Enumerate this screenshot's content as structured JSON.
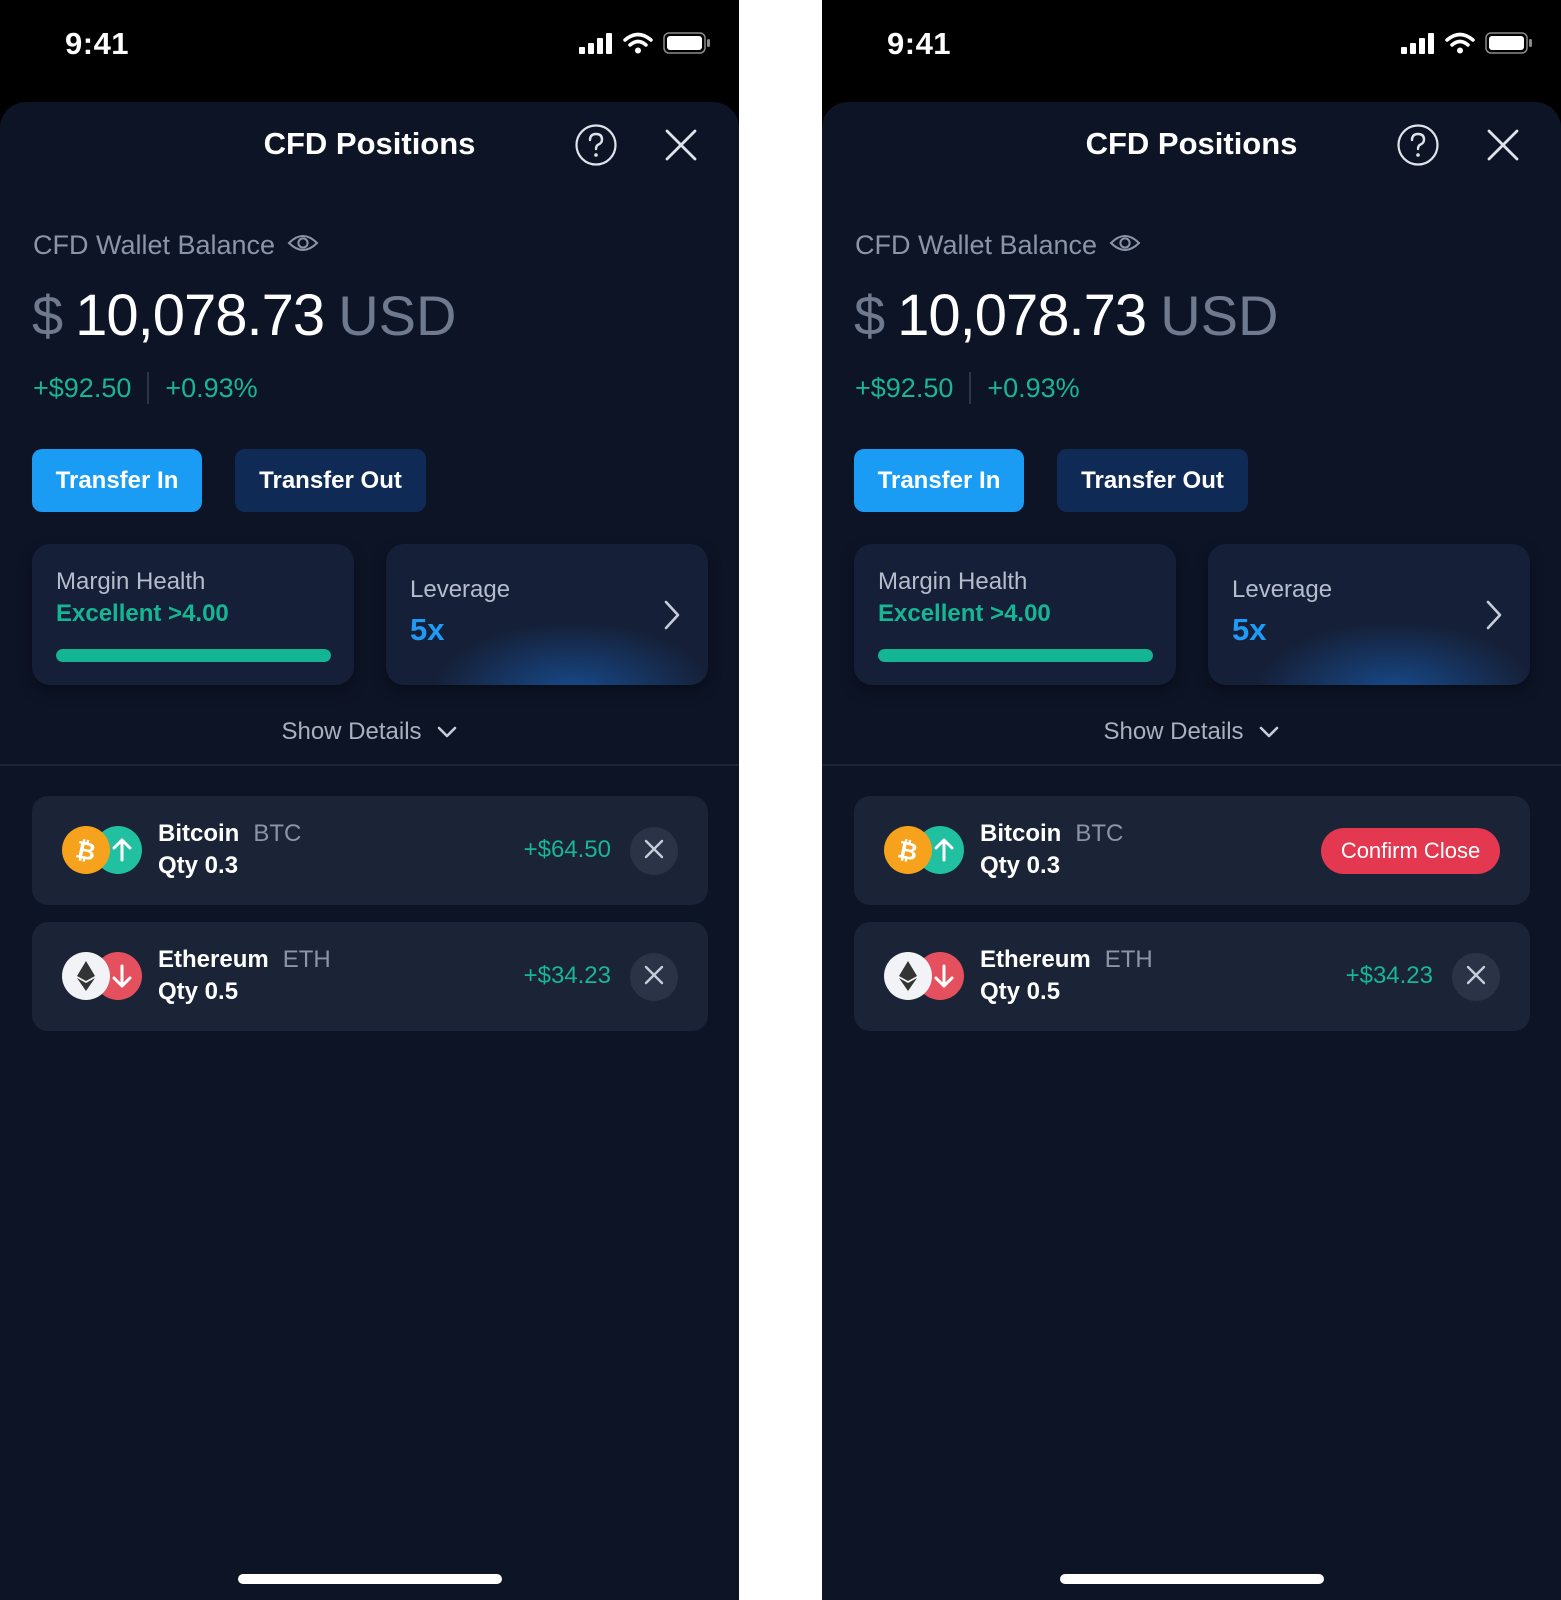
{
  "colors": {
    "accent_blue": "#1a9cf5",
    "positive_green": "#19b594",
    "confirm_red": "#e3384f",
    "sheet_background": "#0d1426",
    "card_background": "#152038"
  },
  "icons": {
    "help": "question-circle-icon",
    "close": "x-close-icon",
    "visibility": "eye-icon",
    "expand": "chevron-down-icon",
    "navigate": "chevron-right-icon",
    "bitcoin": "bitcoin-icon",
    "ethereum": "ethereum-icon",
    "long": "arrow-up-icon",
    "short": "arrow-down-icon"
  },
  "screens": [
    {
      "status": {
        "time": "9:41"
      },
      "header": {
        "title": "CFD Positions"
      },
      "balance": {
        "label": "CFD Wallet Balance",
        "currency_symbol": "$",
        "amount": "10,078.73",
        "unit": "USD",
        "change_amount": "+$92.50",
        "change_percent": "+0.93%"
      },
      "actions": {
        "transfer_in": "Transfer In",
        "transfer_out": "Transfer Out"
      },
      "margin": {
        "label": "Margin Health",
        "status": "Excellent >4.00",
        "fill_fraction": 1.0
      },
      "leverage": {
        "label": "Leverage",
        "value": "5x"
      },
      "details_toggle": "Show Details",
      "positions": [
        {
          "name": "Bitcoin",
          "symbol": "BTC",
          "qty": "Qty 0.3",
          "direction": "long",
          "pnl": "+$64.50",
          "confirm_label": ""
        },
        {
          "name": "Ethereum",
          "symbol": "ETH",
          "qty": "Qty 0.5",
          "direction": "short",
          "pnl": "+$34.23",
          "confirm_label": ""
        }
      ]
    },
    {
      "status": {
        "time": "9:41"
      },
      "header": {
        "title": "CFD Positions"
      },
      "balance": {
        "label": "CFD Wallet Balance",
        "currency_symbol": "$",
        "amount": "10,078.73",
        "unit": "USD",
        "change_amount": "+$92.50",
        "change_percent": "+0.93%"
      },
      "actions": {
        "transfer_in": "Transfer In",
        "transfer_out": "Transfer Out"
      },
      "margin": {
        "label": "Margin Health",
        "status": "Excellent >4.00",
        "fill_fraction": 1.0
      },
      "leverage": {
        "label": "Leverage",
        "value": "5x"
      },
      "details_toggle": "Show Details",
      "positions": [
        {
          "name": "Bitcoin",
          "symbol": "BTC",
          "qty": "Qty 0.3",
          "direction": "long",
          "pnl": "",
          "confirm_label": "Confirm Close"
        },
        {
          "name": "Ethereum",
          "symbol": "ETH",
          "qty": "Qty 0.5",
          "direction": "short",
          "pnl": "+$34.23",
          "confirm_label": ""
        }
      ]
    }
  ]
}
